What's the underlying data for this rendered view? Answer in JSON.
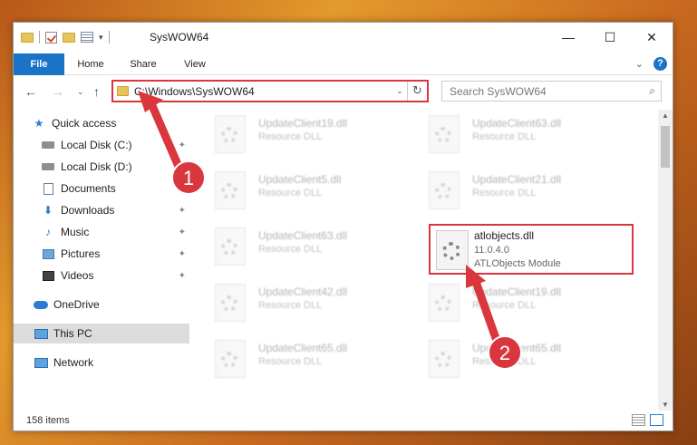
{
  "window": {
    "title": "SysWOW64",
    "minimize": "—",
    "maximize": "☐",
    "close": "✕"
  },
  "ribbon": {
    "tabs": [
      "File",
      "Home",
      "Share",
      "View"
    ],
    "expand": "⌄",
    "help": "?"
  },
  "nav": {
    "back": "←",
    "forward": "→",
    "recent": "⌄",
    "up": "↑",
    "address": "C:\\Windows\\SysWOW64",
    "address_drop": "⌄",
    "refresh": "↻",
    "search_placeholder": "Search SysWOW64",
    "search_icon": "⌕"
  },
  "sidebar": {
    "items": [
      {
        "label": "Quick access",
        "icon": "star-icon",
        "pinned": false
      },
      {
        "label": "Local Disk (C:)",
        "icon": "drive-icon",
        "pinned": true
      },
      {
        "label": "Local Disk (D:)",
        "icon": "drive-icon",
        "pinned": false
      },
      {
        "label": "Documents",
        "icon": "documents-icon",
        "pinned": true
      },
      {
        "label": "Downloads",
        "icon": "downloads-icon",
        "pinned": true
      },
      {
        "label": "Music",
        "icon": "music-icon",
        "pinned": true
      },
      {
        "label": "Pictures",
        "icon": "pictures-icon",
        "pinned": true
      },
      {
        "label": "Videos",
        "icon": "videos-icon",
        "pinned": true
      },
      {
        "label": "OneDrive",
        "icon": "onedrive-icon",
        "pinned": false
      },
      {
        "label": "This PC",
        "icon": "this-pc-icon",
        "pinned": false,
        "selected": true
      },
      {
        "label": "Network",
        "icon": "network-icon",
        "pinned": false
      }
    ],
    "pin_glyph": "📌"
  },
  "files": {
    "left": [
      {
        "name": "UpdateClient19.dll",
        "desc": "Resource DLL"
      },
      {
        "name": "UpdateClient5.dll",
        "desc": "Resource DLL"
      },
      {
        "name": "UpdateClient63.dll",
        "desc": "Resource DLL"
      },
      {
        "name": "UpdateClient42.dll",
        "desc": "Resource DLL"
      },
      {
        "name": "UpdateClient65.dll",
        "desc": "Resource DLL"
      }
    ],
    "right": [
      {
        "name": "UpdateClient63.dll",
        "desc": "Resource DLL"
      },
      {
        "name": "UpdateClient21.dll",
        "desc": "Resource DLL"
      },
      {
        "name": "UpdateClient19.dll",
        "desc": "Resource DLL"
      },
      {
        "name": "UpdateClient65.dll",
        "desc": "Resource DLL"
      }
    ],
    "selected": {
      "name": "atlobjects.dll",
      "version": "11.0.4.0",
      "desc": "ATLObjects Module"
    }
  },
  "status": {
    "count": "158 items"
  },
  "annotations": {
    "step1": "1",
    "step2": "2",
    "color": "#d9363e"
  }
}
